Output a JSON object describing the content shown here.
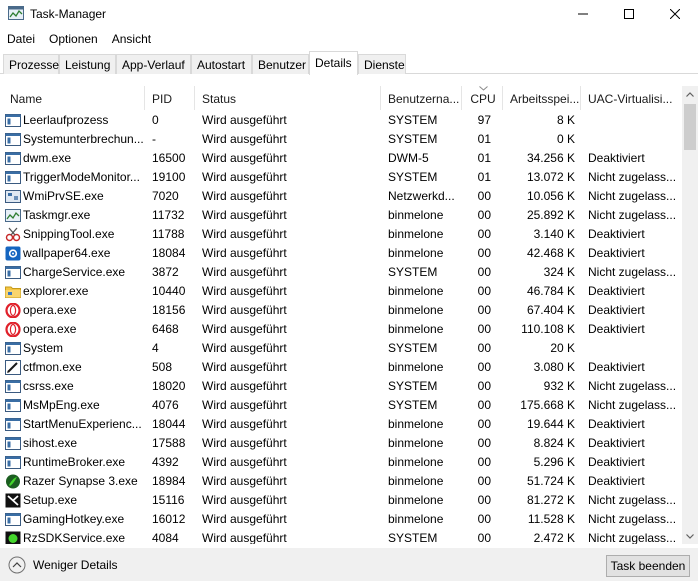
{
  "window": {
    "title": "Task-Manager",
    "icon": "task-manager-icon"
  },
  "menu": [
    "Datei",
    "Optionen",
    "Ansicht"
  ],
  "tabs": [
    {
      "label": "Prozesse"
    },
    {
      "label": "Leistung"
    },
    {
      "label": "App-Verlauf"
    },
    {
      "label": "Autostart"
    },
    {
      "label": "Benutzer"
    },
    {
      "label": "Details",
      "active": true
    },
    {
      "label": "Dienste"
    }
  ],
  "columns": [
    "Name",
    "PID",
    "Status",
    "Benutzerna...",
    "CPU",
    "Arbeitsspei...",
    "UAC-Virtualisi..."
  ],
  "sort_column": "CPU",
  "processes": [
    {
      "name": "Leerlaufprozess",
      "pid": "0",
      "status": "Wird ausgeführt",
      "user": "SYSTEM",
      "cpu": "97",
      "mem": "8 K",
      "uac": "",
      "icon": "default-process-icon"
    },
    {
      "name": "Systemunterbrechun...",
      "pid": "-",
      "status": "Wird ausgeführt",
      "user": "SYSTEM",
      "cpu": "01",
      "mem": "0 K",
      "uac": "",
      "icon": "default-process-icon"
    },
    {
      "name": "dwm.exe",
      "pid": "16500",
      "status": "Wird ausgeführt",
      "user": "DWM-5",
      "cpu": "01",
      "mem": "34.256 K",
      "uac": "Deaktiviert",
      "icon": "default-process-icon"
    },
    {
      "name": "TriggerModeMonitor...",
      "pid": "19100",
      "status": "Wird ausgeführt",
      "user": "SYSTEM",
      "cpu": "01",
      "mem": "13.072 K",
      "uac": "Nicht zugelass...",
      "icon": "default-process-icon"
    },
    {
      "name": "WmiPrvSE.exe",
      "pid": "7020",
      "status": "Wird ausgeführt",
      "user": "Netzwerkd...",
      "cpu": "00",
      "mem": "10.056 K",
      "uac": "Nicht zugelass...",
      "icon": "wmi-icon"
    },
    {
      "name": "Taskmgr.exe",
      "pid": "11732",
      "status": "Wird ausgeführt",
      "user": "binmelone",
      "cpu": "00",
      "mem": "25.892 K",
      "uac": "Nicht zugelass...",
      "icon": "task-manager-icon"
    },
    {
      "name": "SnippingTool.exe",
      "pid": "11788",
      "status": "Wird ausgeführt",
      "user": "binmelone",
      "cpu": "00",
      "mem": "3.140 K",
      "uac": "Deaktiviert",
      "icon": "scissors-icon"
    },
    {
      "name": "wallpaper64.exe",
      "pid": "18084",
      "status": "Wird ausgeführt",
      "user": "binmelone",
      "cpu": "00",
      "mem": "42.468 K",
      "uac": "Deaktiviert",
      "icon": "gear-icon"
    },
    {
      "name": "ChargeService.exe",
      "pid": "3872",
      "status": "Wird ausgeführt",
      "user": "SYSTEM",
      "cpu": "00",
      "mem": "324 K",
      "uac": "Nicht zugelass...",
      "icon": "default-process-icon"
    },
    {
      "name": "explorer.exe",
      "pid": "10440",
      "status": "Wird ausgeführt",
      "user": "binmelone",
      "cpu": "00",
      "mem": "46.784 K",
      "uac": "Deaktiviert",
      "icon": "folder-icon"
    },
    {
      "name": "opera.exe",
      "pid": "18156",
      "status": "Wird ausgeführt",
      "user": "binmelone",
      "cpu": "00",
      "mem": "67.404 K",
      "uac": "Deaktiviert",
      "icon": "opera-icon"
    },
    {
      "name": "opera.exe",
      "pid": "6468",
      "status": "Wird ausgeführt",
      "user": "binmelone",
      "cpu": "00",
      "mem": "110.108 K",
      "uac": "Deaktiviert",
      "icon": "opera-icon"
    },
    {
      "name": "System",
      "pid": "4",
      "status": "Wird ausgeführt",
      "user": "SYSTEM",
      "cpu": "00",
      "mem": "20 K",
      "uac": "",
      "icon": "default-process-icon"
    },
    {
      "name": "ctfmon.exe",
      "pid": "508",
      "status": "Wird ausgeführt",
      "user": "binmelone",
      "cpu": "00",
      "mem": "3.080 K",
      "uac": "Deaktiviert",
      "icon": "pen-icon"
    },
    {
      "name": "csrss.exe",
      "pid": "18020",
      "status": "Wird ausgeführt",
      "user": "SYSTEM",
      "cpu": "00",
      "mem": "932 K",
      "uac": "Nicht zugelass...",
      "icon": "default-process-icon"
    },
    {
      "name": "MsMpEng.exe",
      "pid": "4076",
      "status": "Wird ausgeführt",
      "user": "SYSTEM",
      "cpu": "00",
      "mem": "175.668 K",
      "uac": "Nicht zugelass...",
      "icon": "default-process-icon"
    },
    {
      "name": "StartMenuExperienc...",
      "pid": "18044",
      "status": "Wird ausgeführt",
      "user": "binmelone",
      "cpu": "00",
      "mem": "19.644 K",
      "uac": "Deaktiviert",
      "icon": "default-process-icon"
    },
    {
      "name": "sihost.exe",
      "pid": "17588",
      "status": "Wird ausgeführt",
      "user": "binmelone",
      "cpu": "00",
      "mem": "8.824 K",
      "uac": "Deaktiviert",
      "icon": "default-process-icon"
    },
    {
      "name": "RuntimeBroker.exe",
      "pid": "4392",
      "status": "Wird ausgeführt",
      "user": "binmelone",
      "cpu": "00",
      "mem": "5.296 K",
      "uac": "Deaktiviert",
      "icon": "default-process-icon"
    },
    {
      "name": "Razer Synapse 3.exe",
      "pid": "18984",
      "status": "Wird ausgeführt",
      "user": "binmelone",
      "cpu": "00",
      "mem": "51.724 K",
      "uac": "Deaktiviert",
      "icon": "razer-icon"
    },
    {
      "name": "Setup.exe",
      "pid": "15116",
      "status": "Wird ausgeführt",
      "user": "binmelone",
      "cpu": "00",
      "mem": "81.272 K",
      "uac": "Nicht zugelass...",
      "icon": "setup-icon"
    },
    {
      "name": "GamingHotkey.exe",
      "pid": "16012",
      "status": "Wird ausgeführt",
      "user": "binmelone",
      "cpu": "00",
      "mem": "11.528 K",
      "uac": "Nicht zugelass...",
      "icon": "default-process-icon"
    },
    {
      "name": "RzSDKService.exe",
      "pid": "4084",
      "status": "Wird ausgeführt",
      "user": "SYSTEM",
      "cpu": "00",
      "mem": "2.472 K",
      "uac": "Nicht zugelass...",
      "icon": "razer-sdk-icon"
    }
  ],
  "footer": {
    "less_details": "Weniger Details",
    "end_task": "Task beenden"
  },
  "colors": {
    "window_bg": "#ffffff",
    "footer_bg": "#f0f0f0",
    "tab_bg": "#f0f0f0",
    "button_bg": "#e1e1e1",
    "scroll_thumb": "#cdcdcd"
  }
}
